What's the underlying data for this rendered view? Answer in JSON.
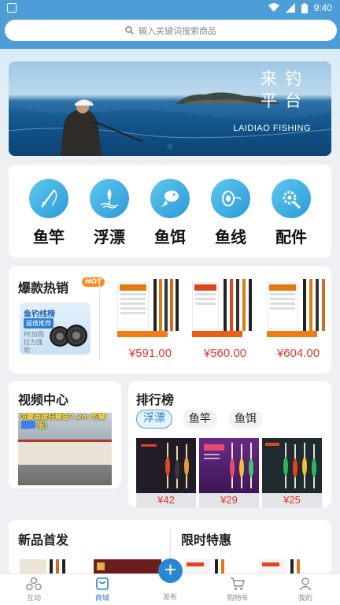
{
  "status_bar": {
    "time": "9:40"
  },
  "search": {
    "placeholder": "输入关键词搜索商品"
  },
  "banner": {
    "title_line1": "来钓",
    "title_line2": "平台",
    "subtitle": "LAIDIAO FISHING"
  },
  "categories": [
    {
      "label": "鱼竿",
      "icon": "fishing-rod-icon"
    },
    {
      "label": "浮漂",
      "icon": "float-icon"
    },
    {
      "label": "鱼饵",
      "icon": "bait-icon"
    },
    {
      "label": "鱼线",
      "icon": "fishing-line-icon"
    },
    {
      "label": "配件",
      "icon": "accessories-gear-icon"
    }
  ],
  "hot_sales": {
    "title": "爆款热销",
    "badge": "HOT",
    "promo": {
      "line1": "鱼钓线榜",
      "line2": "超值推荐",
      "line3": "PE加固 拉力强劲"
    },
    "products": [
      {
        "price": "¥591.00"
      },
      {
        "price": "¥560.00"
      },
      {
        "price": "¥604.00"
      }
    ]
  },
  "video_center": {
    "title": "视频中心",
    "caption": "仿藏高碳好鲫鱼7.2m 钓鲫(第一版)"
  },
  "ranking": {
    "title": "排行榜",
    "tabs": [
      "浮漂",
      "鱼竿",
      "鱼饵"
    ],
    "active_tab": "浮漂",
    "products": [
      {
        "price": "¥42"
      },
      {
        "price": "¥29"
      },
      {
        "price": "¥25"
      }
    ]
  },
  "new_products": {
    "title": "新品首发"
  },
  "flash_sale": {
    "title": "限时特惠"
  },
  "tab_bar": {
    "items": [
      {
        "label": "互动",
        "icon": "interact-icon"
      },
      {
        "label": "商城",
        "icon": "mall-icon"
      },
      {
        "label": "发布",
        "icon": "publish-plus-icon"
      },
      {
        "label": "购物车",
        "icon": "cart-icon"
      },
      {
        "label": "我的",
        "icon": "profile-icon"
      }
    ],
    "active": "商城",
    "fab_symbol": "+"
  },
  "colors": {
    "primary": "#4d9ed6",
    "accent": "#2b80c4",
    "price": "#e2352c",
    "hot": "#ff8a1f"
  }
}
